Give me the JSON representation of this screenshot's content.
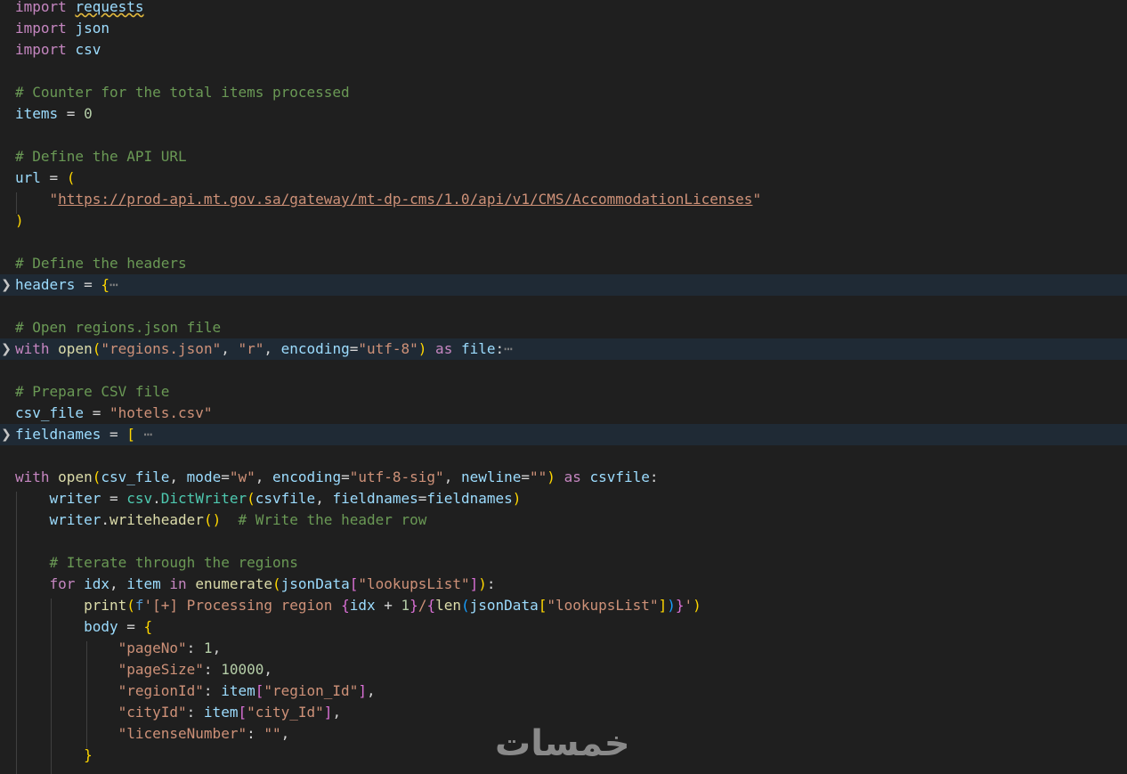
{
  "colors": {
    "background": "#1f1f1f",
    "folded_highlight": "#1f2a35",
    "keyword": "#c586c0",
    "variable": "#9cdcfe",
    "string": "#ce9178",
    "comment": "#6a9955",
    "function": "#dcdcaa",
    "number": "#b5cea8"
  },
  "icons": {
    "fold": "chevron-right-icon",
    "folded_ellipsis": "ellipsis"
  },
  "code": {
    "l1": [
      "import",
      "requests"
    ],
    "l2": [
      "import",
      "json"
    ],
    "l3": [
      "import",
      "csv"
    ],
    "l5": "# Counter for the total items processed",
    "l6": [
      "items",
      " = ",
      "0"
    ],
    "l8": "# Define the API URL",
    "l9": [
      "url",
      " = ",
      "("
    ],
    "l10": [
      "\"",
      "https://prod-api.mt.gov.sa/gateway/mt-dp-cms/1.0/api/v1/CMS/AccommodationLicenses",
      "\""
    ],
    "l11": ")",
    "l13": "# Define the headers",
    "l14": [
      "headers",
      " = ",
      "{",
      "⋯"
    ],
    "l16": "# Open regions.json file",
    "l17": [
      "with",
      "open",
      "(",
      "\"regions.json\"",
      ", ",
      "\"r\"",
      ", ",
      "encoding",
      "=",
      "\"utf-8\"",
      ")",
      " as ",
      "file",
      ":",
      "⋯"
    ],
    "l19": "# Prepare CSV file",
    "l20": [
      "csv_file",
      " = ",
      "\"hotels.csv\""
    ],
    "l21": [
      "fieldnames",
      " = ",
      "[",
      " ⋯"
    ],
    "l23": [
      "with",
      "open",
      "(",
      "csv_file",
      ", ",
      "mode",
      "=",
      "\"w\"",
      ", ",
      "encoding",
      "=",
      "\"utf-8-sig\"",
      ", ",
      "newline",
      "=",
      "\"\"",
      ")",
      " as ",
      "csvfile",
      ":"
    ],
    "l24": [
      "writer",
      " = ",
      "csv",
      ".",
      "DictWriter",
      "(",
      "csvfile",
      ", ",
      "fieldnames",
      "=",
      "fieldnames",
      ")"
    ],
    "l25": [
      "writer",
      ".",
      "writeheader",
      "()",
      "  ",
      "# Write the header row"
    ],
    "l27": "# Iterate through the regions",
    "l28": [
      "for",
      "idx",
      ", ",
      "item",
      " in ",
      "enumerate",
      "(",
      "jsonData",
      "[",
      "\"lookupsList\"",
      "]",
      ")",
      ":"
    ],
    "l29": [
      "print",
      "(",
      "f",
      "'[+] Processing region ",
      "{",
      "idx",
      " + ",
      "1",
      "}",
      "/",
      "{",
      "len",
      "(",
      "jsonData",
      "[",
      "\"lookupsList\"",
      "]",
      ")",
      "}",
      "'",
      ")"
    ],
    "l30": [
      "body",
      " = ",
      "{"
    ],
    "l31": [
      "\"pageNo\"",
      ": ",
      "1",
      ","
    ],
    "l32": [
      "\"pageSize\"",
      ": ",
      "10000",
      ","
    ],
    "l33": [
      "\"regionId\"",
      ": ",
      "item",
      "[",
      "\"region_Id\"",
      "]",
      ","
    ],
    "l34": [
      "\"cityId\"",
      ": ",
      "item",
      "[",
      "\"city_Id\"",
      "]",
      ","
    ],
    "l35": [
      "\"licenseNumber\"",
      ": ",
      "\"\"",
      ","
    ],
    "l36": "}"
  },
  "watermark": "خمسات"
}
